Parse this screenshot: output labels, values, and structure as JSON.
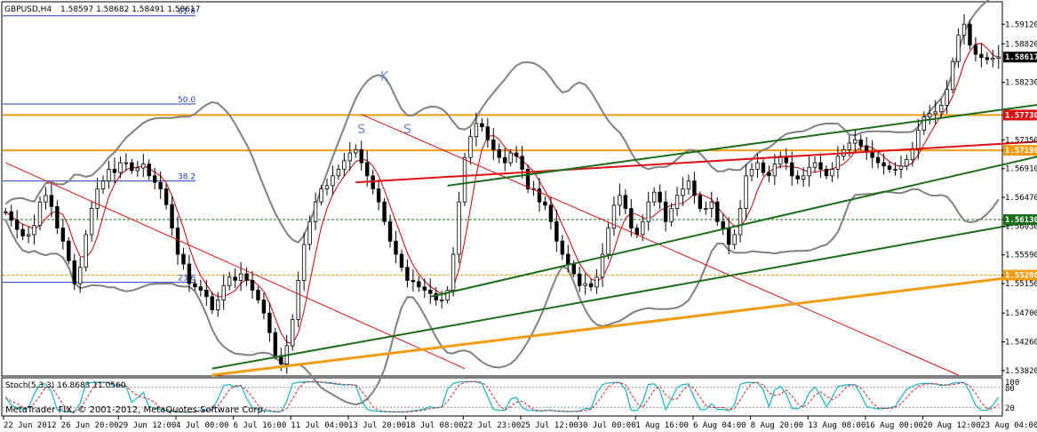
{
  "header": {
    "symbol": "GBPUSD,H4",
    "ohlc": "1.58597 1.58682 1.58491 1.58617"
  },
  "footer": {
    "copyright": "MetaTrader FIX, © 2001-2012, MetaQuotes Software Corp."
  },
  "indicator": {
    "label": "Stoch(5,3,3) 16.8683 11.0560",
    "levels": [
      "100",
      "80",
      "20"
    ]
  },
  "fibonacci": {
    "levels": [
      {
        "label": "61.8",
        "price": 1.5925
      },
      {
        "label": "50.0",
        "price": 1.579
      },
      {
        "label": "38.2",
        "price": 1.5672
      },
      {
        "label": "23.6",
        "price": 1.5517
      }
    ]
  },
  "annotations": [
    {
      "text": "S",
      "xi": 62,
      "price": 1.5745
    },
    {
      "text": "K",
      "xi": 66,
      "price": 1.5826
    },
    {
      "text": "S",
      "xi": 70,
      "price": 1.5745
    }
  ],
  "colors": {
    "up": "#000000",
    "down": "#000000",
    "bollinger": "#808080",
    "ma": "#cc0000",
    "green": "#1a6e1a",
    "orange": "#f39c12",
    "red": "#dd1111",
    "cyan": "#19e0f0",
    "stoch_main": "#16b3c7",
    "stoch_signal": "#dd2222"
  },
  "chart_data": {
    "type": "candlestick",
    "symbol": "GBPUSD",
    "timeframe": "H4",
    "ylim": [
      1.5375,
      1.5945
    ],
    "y_ticks": [
      "1.59120",
      "1.58820",
      "1.58230",
      "1.57730",
      "1.57350",
      "1.57190",
      "1.56910",
      "1.56470",
      "1.56130",
      "1.56030",
      "1.55590",
      "1.55280",
      "1.55150",
      "1.54700",
      "1.54260",
      "1.53820"
    ],
    "price_tags": [
      {
        "value": "1.58617",
        "price": 1.58617,
        "color": "#000000"
      },
      {
        "value": "1.57730",
        "price": 1.5773,
        "color": "#dd1111"
      },
      {
        "value": "1.57190",
        "price": 1.5719,
        "color": "#f39c12"
      },
      {
        "value": "1.56130",
        "price": 1.5613,
        "color": "#1a6e1a"
      },
      {
        "value": "1.55280",
        "price": 1.5528,
        "color": "#f39c12"
      }
    ],
    "x_labels": [
      "22 Jun 2012",
      "26 Jun 20:00",
      "29 Jun 12:00",
      "4 Jul 00:00",
      "6 Jul 16:00",
      "11 Jul 04:00",
      "13 Jul 20:00",
      "18 Jul 08:00",
      "22 Jul 23:00",
      "25 Jul 12:00",
      "30 Jul 00:00",
      "1 Aug 16:00",
      "6 Aug 04:00",
      "8 Aug 20:00",
      "13 Aug 08:00",
      "16 Aug 00:00",
      "20 Aug 12:00",
      "23 Aug 04:00"
    ],
    "horizontal_levels": [
      {
        "price": 1.5773,
        "color": "#f39c12",
        "style": "solid"
      },
      {
        "price": 1.5719,
        "color": "#f39c12",
        "style": "solid"
      },
      {
        "price": 1.5613,
        "color": "#1a6e1a",
        "style": "dashed"
      },
      {
        "price": 1.5528,
        "color": "#f39c12",
        "style": "dashed"
      }
    ],
    "trendlines": [
      {
        "x1": 0,
        "p1": 1.57,
        "x2": 80,
        "p2": 1.5385,
        "color": "#dd1111",
        "width": 1
      },
      {
        "x1": 62,
        "p1": 1.5774,
        "x2": 166,
        "p2": 1.5375,
        "color": "#dd1111",
        "width": 1
      },
      {
        "x1": 61,
        "p1": 1.567,
        "x2": 185,
        "p2": 1.5735,
        "color": "#dd1111",
        "width": 2
      },
      {
        "x1": 36,
        "p1": 1.5375,
        "x2": 185,
        "p2": 1.5535,
        "color": "#f39c12",
        "width": 3
      },
      {
        "x1": 36,
        "p1": 1.5385,
        "x2": 185,
        "p2": 1.562,
        "color": "#1a6e1a",
        "width": 2
      },
      {
        "x1": 74,
        "p1": 1.5495,
        "x2": 185,
        "p2": 1.572,
        "color": "#1a6e1a",
        "width": 2
      },
      {
        "x1": 77,
        "p1": 1.5665,
        "x2": 185,
        "p2": 1.5795,
        "color": "#1a6e1a",
        "width": 2
      }
    ],
    "highlight_box": {
      "x1": 182,
      "x2": 185,
      "p_high": 1.5822,
      "p_low": 1.576
    },
    "close_series": [
      1.5625,
      1.5612,
      1.5598,
      1.5588,
      1.559,
      1.5604,
      1.564,
      1.565,
      1.5633,
      1.56,
      1.558,
      1.555,
      1.5515,
      1.554,
      1.559,
      1.563,
      1.566,
      1.5672,
      1.569,
      1.5685,
      1.57,
      1.57,
      1.5688,
      1.5692,
      1.5698,
      1.568,
      1.567,
      1.566,
      1.5636,
      1.56,
      1.556,
      1.5545,
      1.5515,
      1.551,
      1.5505,
      1.5495,
      1.5475,
      1.549,
      1.5512,
      1.5525,
      1.552,
      1.553,
      1.552,
      1.5505,
      1.549,
      1.547,
      1.544,
      1.5405,
      1.5392,
      1.542,
      1.546,
      1.552,
      1.5575,
      1.561,
      1.564,
      1.566,
      1.5665,
      1.568,
      1.569,
      1.5703,
      1.5715,
      1.572,
      1.57,
      1.568,
      1.566,
      1.564,
      1.561,
      1.558,
      1.556,
      1.554,
      1.552,
      1.5518,
      1.551,
      1.5505,
      1.55,
      1.549,
      1.549,
      1.5505,
      1.556,
      1.564,
      1.5708,
      1.574,
      1.576,
      1.5755,
      1.5735,
      1.572,
      1.5708,
      1.57,
      1.5715,
      1.571,
      1.569,
      1.566,
      1.566,
      1.564,
      1.5635,
      1.561,
      1.558,
      1.556,
      1.5545,
      1.553,
      1.5512,
      1.5515,
      1.551,
      1.5525,
      1.556,
      1.56,
      1.5635,
      1.565,
      1.563,
      1.56,
      1.559,
      1.561,
      1.564,
      1.5655,
      1.564,
      1.561,
      1.563,
      1.565,
      1.566,
      1.5672,
      1.565,
      1.563,
      1.563,
      1.564,
      1.561,
      1.56,
      1.5575,
      1.559,
      1.563,
      1.568,
      1.569,
      1.57,
      1.5685,
      1.568,
      1.5698,
      1.571,
      1.57,
      1.568,
      1.5675,
      1.568,
      1.5693,
      1.57,
      1.569,
      1.568,
      1.569,
      1.571,
      1.572,
      1.573,
      1.5735,
      1.5726,
      1.5716,
      1.5708,
      1.57,
      1.5695,
      1.569,
      1.569,
      1.5695,
      1.5705,
      1.572,
      1.575,
      1.577,
      1.5775,
      1.5778,
      1.5788,
      1.5812,
      1.5855,
      1.5895,
      1.5912,
      1.588,
      1.5866,
      1.5861,
      1.5858,
      1.586,
      1.5862
    ],
    "stochastic": {
      "name": "Stoch(5,3,3)",
      "main": 16.8683,
      "signal": 11.056,
      "levels": [
        100,
        80,
        20
      ]
    }
  }
}
